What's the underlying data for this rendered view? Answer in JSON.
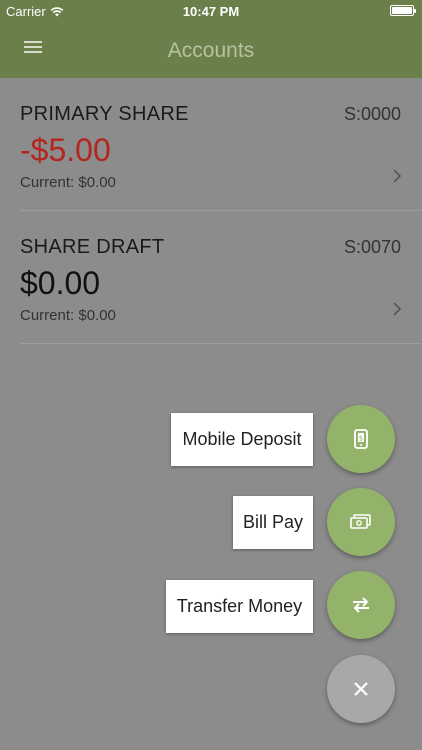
{
  "status_bar": {
    "carrier": "Carrier",
    "time": "10:47 PM"
  },
  "nav": {
    "title": "Accounts"
  },
  "accounts": [
    {
      "name": "PRIMARY SHARE",
      "number": "S:0000",
      "balance": "-$5.00",
      "current": "Current: $0.00"
    },
    {
      "name": "SHARE DRAFT",
      "number": "S:0070",
      "balance": "$0.00",
      "current": "Current: $0.00"
    }
  ],
  "fab_menu": {
    "mobile_deposit": "Mobile Deposit",
    "bill_pay": "Bill Pay",
    "transfer_money": "Transfer Money"
  },
  "colors": {
    "brand_green": "#6a7f4a",
    "fab_green": "#94b36a",
    "negative": "#b3261e",
    "overlay": "#8c8c8c"
  }
}
